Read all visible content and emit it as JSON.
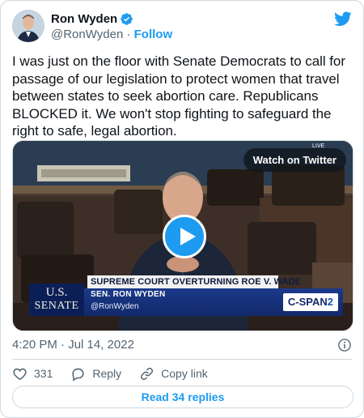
{
  "author": {
    "name": "Ron Wyden",
    "handle": "@RonWyden",
    "separator": "·",
    "follow_label": "Follow"
  },
  "tweet": {
    "text": "I was just on the floor with Senate Democrats to call for passage of our legislation to protect women that travel between states to seek abortion care. Republicans BLOCKED it. We won't stop fighting to safeguard the right to safe, legal abortion."
  },
  "media": {
    "watch_label": "Watch on Twitter",
    "chyron_headline": "SUPREME COURT OVERTURNING ROE V. WADE",
    "chyron_name": "SEN. RON WYDEN",
    "chyron_handle": "@RonWyden",
    "senate_line1": "U.S.",
    "senate_line2": "SENATE",
    "network_prefix": "C-SPAN",
    "network_suffix": "2",
    "live_label": "LIVE"
  },
  "meta": {
    "timestamp": "4:20 PM · Jul 14, 2022"
  },
  "actions": {
    "like_count": "331",
    "reply_label": "Reply",
    "copy_link_label": "Copy link"
  },
  "footer": {
    "read_replies_label": "Read 34 replies"
  },
  "icons": {
    "verified": "verified-badge-icon",
    "brand": "twitter-bird-icon",
    "info": "info-icon",
    "like": "heart-icon",
    "reply": "speech-bubble-icon",
    "copy_link": "link-icon",
    "play": "play-icon"
  },
  "colors": {
    "accent": "#1d9bf0",
    "text": "#0f1419",
    "secondary": "#536471",
    "border": "#cfd9de"
  }
}
